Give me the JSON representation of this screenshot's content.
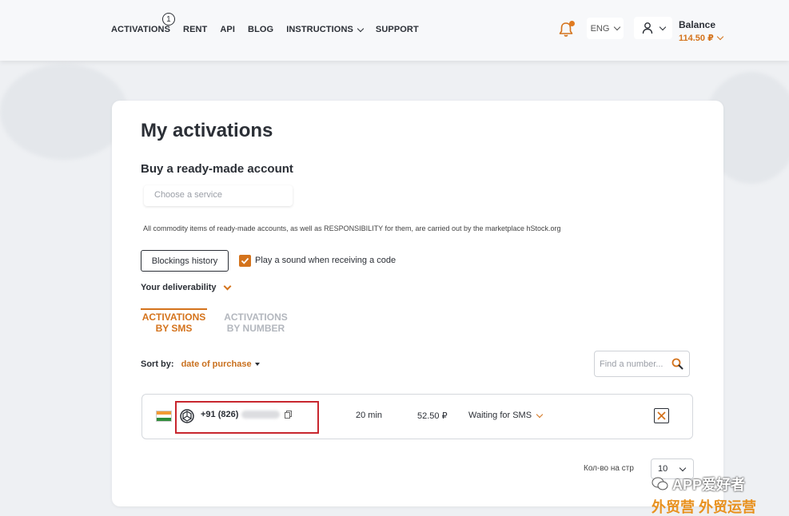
{
  "nav": {
    "items": [
      "ACTIVATIONS",
      "RENT",
      "API",
      "BLOG",
      "INSTRUCTIONS",
      "SUPPORT"
    ],
    "activations_badge": "1"
  },
  "header": {
    "language": "ENG",
    "balance_label": "Balance",
    "balance_value": "114.50 ₽",
    "notification_color": "#e07a1f"
  },
  "page": {
    "title": "My activations",
    "buy_section_title": "Buy a ready-made account",
    "service_placeholder": "Choose a service",
    "disclaimer": "All commodity items of ready-made accounts, as well as RESPONSIBILITY for them, are carried out by the marketplace hStock.org",
    "blockings_button": "Blockings history",
    "sound_checkbox_label": "Play a sound when receiving a code",
    "sound_checked": true,
    "deliverability_label": "Your deliverability",
    "tabs": [
      {
        "line1": "ACTIVATIONS",
        "line2": "BY SMS",
        "active": true
      },
      {
        "line1": "ACTIVATIONS",
        "line2": "BY NUMBER",
        "active": false
      }
    ],
    "sort_label": "Sort by:",
    "sort_value": "date of purchase",
    "search_placeholder": "Find a number...",
    "per_page_label": "Кол-во на стр",
    "per_page_value": "10"
  },
  "activations": [
    {
      "country_flag": "india-flag",
      "service_icon": "openai-icon",
      "phone": "+91 (826)",
      "duration": "20 min",
      "price": "52.50 ₽",
      "status": "Waiting for SMS"
    }
  ],
  "watermark": {
    "line1": "APP爱好者",
    "line2": "外贸营 外贸运营"
  },
  "colors": {
    "accent": "#d4731c",
    "highlight_box": "#c8262e"
  }
}
